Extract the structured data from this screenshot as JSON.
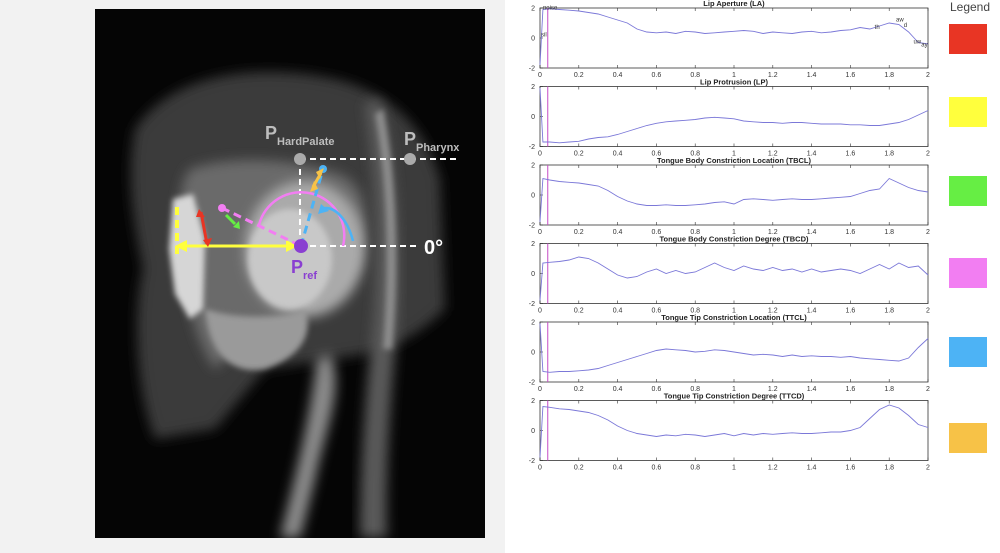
{
  "figure": {
    "mri_labels": {
      "hard_palate": "P",
      "hard_palate_sub": "HardPalate",
      "pharynx": "P",
      "pharynx_sub": "Pharynx",
      "ref": "P",
      "ref_sub": "ref",
      "zero_angle": "0°"
    },
    "legend": {
      "title": "Legend",
      "colors": [
        "#e83524",
        "#ffff3d",
        "#66ee44",
        "#f27ef2",
        "#4db3f5",
        "#f7c247"
      ]
    }
  },
  "chart_data": [
    {
      "type": "line",
      "title": "Lip Aperture (LA)",
      "xlim": [
        0,
        2
      ],
      "ylim": [
        -2,
        2
      ],
      "xticks": [
        0,
        0.2,
        0.4,
        0.6,
        0.8,
        1,
        1.2,
        1.4,
        1.6,
        1.8,
        2
      ],
      "yticks": [
        2,
        0,
        -2
      ],
      "cursor_x": 0.04,
      "annotations": [
        {
          "text": "noise",
          "x": 0.01,
          "y": 1.9
        },
        {
          "text": "sil",
          "x": 0.0,
          "y": 0.1
        },
        {
          "text": "th",
          "x": 1.72,
          "y": 0.6
        },
        {
          "text": "aw",
          "x": 1.83,
          "y": 1.1
        },
        {
          "text": "d",
          "x": 1.87,
          "y": 0.75
        },
        {
          "text": "uw",
          "x": 1.92,
          "y": -0.35
        },
        {
          "text": "ay",
          "x": 1.96,
          "y": -0.55
        }
      ],
      "series": [
        {
          "x": [
            0,
            0.015,
            0.05,
            0.1,
            0.15,
            0.2,
            0.25,
            0.3,
            0.35,
            0.4,
            0.45,
            0.5,
            0.55,
            0.6,
            0.65,
            0.7,
            0.75,
            0.8,
            0.85,
            0.9,
            0.95,
            1.0,
            1.05,
            1.1,
            1.15,
            1.2,
            1.25,
            1.3,
            1.35,
            1.4,
            1.45,
            1.5,
            1.55,
            1.6,
            1.65,
            1.7,
            1.75,
            1.8,
            1.85,
            1.9,
            1.95,
            2.0
          ],
          "y": [
            -1.8,
            1.9,
            1.95,
            1.9,
            1.85,
            1.8,
            1.7,
            1.6,
            1.4,
            1.2,
            1.0,
            0.6,
            0.4,
            0.35,
            0.4,
            0.3,
            0.45,
            0.4,
            0.3,
            0.35,
            0.4,
            0.45,
            0.5,
            0.45,
            0.3,
            0.4,
            0.35,
            0.3,
            0.4,
            0.45,
            0.35,
            0.4,
            0.5,
            0.55,
            0.7,
            0.6,
            0.8,
            1.0,
            0.9,
            0.4,
            -0.3,
            -0.4
          ]
        }
      ]
    },
    {
      "type": "line",
      "title": "Lip Protrusion (LP)",
      "xlim": [
        0,
        2
      ],
      "ylim": [
        -2,
        2
      ],
      "xticks": [
        0,
        0.2,
        0.4,
        0.6,
        0.8,
        1,
        1.2,
        1.4,
        1.6,
        1.8,
        2
      ],
      "yticks": [
        2,
        0,
        -2
      ],
      "cursor_x": 0.04,
      "annotations": [],
      "series": [
        {
          "x": [
            0,
            0.015,
            0.05,
            0.1,
            0.15,
            0.2,
            0.25,
            0.3,
            0.35,
            0.4,
            0.45,
            0.5,
            0.55,
            0.6,
            0.65,
            0.7,
            0.75,
            0.8,
            0.85,
            0.9,
            0.95,
            1.0,
            1.05,
            1.1,
            1.15,
            1.2,
            1.25,
            1.3,
            1.35,
            1.4,
            1.45,
            1.5,
            1.55,
            1.6,
            1.65,
            1.7,
            1.75,
            1.8,
            1.85,
            1.9,
            1.95,
            2.0
          ],
          "y": [
            1.9,
            -1.7,
            -1.7,
            -1.75,
            -1.7,
            -1.65,
            -1.5,
            -1.4,
            -1.35,
            -1.2,
            -1.0,
            -0.8,
            -0.6,
            -0.45,
            -0.35,
            -0.3,
            -0.25,
            -0.2,
            -0.1,
            -0.05,
            -0.1,
            -0.15,
            -0.3,
            -0.35,
            -0.4,
            -0.4,
            -0.45,
            -0.4,
            -0.4,
            -0.45,
            -0.5,
            -0.5,
            -0.5,
            -0.55,
            -0.55,
            -0.6,
            -0.6,
            -0.5,
            -0.4,
            -0.2,
            0.1,
            0.4
          ]
        }
      ]
    },
    {
      "type": "line",
      "title": "Tongue Body Constriction Location (TBCL)",
      "xlim": [
        0,
        2
      ],
      "ylim": [
        -2,
        2
      ],
      "xticks": [
        0,
        0.2,
        0.4,
        0.6,
        0.8,
        1,
        1.2,
        1.4,
        1.6,
        1.8,
        2
      ],
      "yticks": [
        2,
        0,
        -2
      ],
      "cursor_x": 0.04,
      "annotations": [],
      "series": [
        {
          "x": [
            0,
            0.015,
            0.05,
            0.1,
            0.15,
            0.2,
            0.25,
            0.3,
            0.35,
            0.4,
            0.45,
            0.5,
            0.55,
            0.6,
            0.65,
            0.7,
            0.75,
            0.8,
            0.85,
            0.9,
            0.95,
            1.0,
            1.05,
            1.1,
            1.15,
            1.2,
            1.25,
            1.3,
            1.35,
            1.4,
            1.45,
            1.5,
            1.55,
            1.6,
            1.65,
            1.7,
            1.75,
            1.8,
            1.85,
            1.9,
            1.95,
            2.0
          ],
          "y": [
            -1.8,
            1.1,
            1.0,
            0.9,
            0.85,
            0.8,
            0.7,
            0.6,
            0.3,
            -0.1,
            -0.4,
            -0.6,
            -0.7,
            -0.7,
            -0.65,
            -0.7,
            -0.7,
            -0.65,
            -0.6,
            -0.5,
            -0.45,
            -0.6,
            -0.3,
            -0.25,
            -0.3,
            -0.35,
            -0.3,
            -0.25,
            -0.3,
            -0.3,
            -0.25,
            -0.2,
            -0.15,
            -0.1,
            0.1,
            0.3,
            0.4,
            1.1,
            0.8,
            0.5,
            0.3,
            0.2
          ]
        }
      ]
    },
    {
      "type": "line",
      "title": "Tongue Body Constriction Degree (TBCD)",
      "xlim": [
        0,
        2
      ],
      "ylim": [
        -2,
        2
      ],
      "xticks": [
        0,
        0.2,
        0.4,
        0.6,
        0.8,
        1,
        1.2,
        1.4,
        1.6,
        1.8,
        2
      ],
      "yticks": [
        2,
        0,
        -2
      ],
      "cursor_x": 0.04,
      "annotations": [],
      "series": [
        {
          "x": [
            0,
            0.015,
            0.05,
            0.1,
            0.15,
            0.2,
            0.25,
            0.3,
            0.35,
            0.4,
            0.45,
            0.5,
            0.55,
            0.6,
            0.65,
            0.7,
            0.75,
            0.8,
            0.85,
            0.9,
            0.95,
            1.0,
            1.05,
            1.1,
            1.15,
            1.2,
            1.25,
            1.3,
            1.35,
            1.4,
            1.45,
            1.5,
            1.55,
            1.6,
            1.65,
            1.7,
            1.75,
            1.8,
            1.85,
            1.9,
            1.95,
            2.0
          ],
          "y": [
            -1.8,
            0.7,
            0.75,
            0.8,
            0.9,
            1.1,
            1.0,
            0.7,
            0.3,
            -0.1,
            -0.3,
            -0.2,
            0.1,
            0.3,
            0.0,
            0.2,
            0.0,
            0.1,
            0.4,
            0.7,
            0.4,
            0.2,
            0.5,
            0.3,
            0.2,
            0.4,
            0.2,
            0.3,
            0.1,
            0.3,
            0.1,
            0.2,
            0.3,
            0.2,
            0.0,
            0.3,
            0.6,
            0.3,
            0.7,
            0.4,
            0.5,
            -0.1
          ]
        }
      ]
    },
    {
      "type": "line",
      "title": "Tongue Tip Constriction Location (TTCL)",
      "xlim": [
        0,
        2
      ],
      "ylim": [
        -2,
        2
      ],
      "xticks": [
        0,
        0.2,
        0.4,
        0.6,
        0.8,
        1,
        1.2,
        1.4,
        1.6,
        1.8,
        2
      ],
      "yticks": [
        2,
        0,
        -2
      ],
      "cursor_x": 0.04,
      "annotations": [],
      "series": [
        {
          "x": [
            0,
            0.015,
            0.05,
            0.1,
            0.15,
            0.2,
            0.25,
            0.3,
            0.35,
            0.4,
            0.45,
            0.5,
            0.55,
            0.6,
            0.65,
            0.7,
            0.75,
            0.8,
            0.85,
            0.9,
            0.95,
            1.0,
            1.05,
            1.1,
            1.15,
            1.2,
            1.25,
            1.3,
            1.35,
            1.4,
            1.45,
            1.5,
            1.55,
            1.6,
            1.65,
            1.7,
            1.75,
            1.8,
            1.85,
            1.9,
            1.95,
            2.0
          ],
          "y": [
            1.9,
            -1.3,
            -1.35,
            -1.3,
            -1.3,
            -1.25,
            -1.2,
            -1.1,
            -0.9,
            -0.7,
            -0.5,
            -0.3,
            -0.1,
            0.1,
            0.2,
            0.15,
            0.1,
            0.0,
            0.05,
            0.15,
            0.1,
            0.0,
            -0.1,
            -0.2,
            -0.15,
            -0.2,
            -0.3,
            -0.2,
            -0.3,
            -0.25,
            -0.3,
            -0.3,
            -0.35,
            -0.3,
            -0.4,
            -0.45,
            -0.5,
            -0.55,
            -0.6,
            -0.4,
            0.3,
            0.9
          ]
        }
      ]
    },
    {
      "type": "line",
      "title": "Tongue Tip Constriction Degree (TTCD)",
      "xlim": [
        0,
        2
      ],
      "ylim": [
        -2,
        2
      ],
      "xticks": [
        0,
        0.2,
        0.4,
        0.6,
        0.8,
        1,
        1.2,
        1.4,
        1.6,
        1.8,
        2
      ],
      "yticks": [
        2,
        0,
        -2
      ],
      "cursor_x": 0.04,
      "annotations": [],
      "series": [
        {
          "x": [
            0,
            0.015,
            0.05,
            0.1,
            0.15,
            0.2,
            0.25,
            0.3,
            0.35,
            0.4,
            0.45,
            0.5,
            0.55,
            0.6,
            0.65,
            0.7,
            0.75,
            0.8,
            0.85,
            0.9,
            0.95,
            1.0,
            1.05,
            1.1,
            1.15,
            1.2,
            1.25,
            1.3,
            1.35,
            1.4,
            1.45,
            1.5,
            1.55,
            1.6,
            1.65,
            1.7,
            1.75,
            1.8,
            1.85,
            1.9,
            1.95,
            2.0
          ],
          "y": [
            -1.8,
            1.6,
            1.55,
            1.45,
            1.4,
            1.3,
            1.2,
            1.0,
            0.7,
            0.3,
            0.0,
            -0.2,
            -0.3,
            -0.4,
            -0.3,
            -0.35,
            -0.25,
            -0.3,
            -0.4,
            -0.3,
            -0.2,
            -0.35,
            -0.2,
            -0.3,
            -0.2,
            -0.25,
            -0.2,
            -0.15,
            -0.2,
            -0.2,
            -0.15,
            -0.1,
            -0.1,
            0.0,
            0.2,
            0.8,
            1.4,
            1.7,
            1.5,
            1.0,
            0.4,
            0.2
          ]
        }
      ]
    }
  ]
}
